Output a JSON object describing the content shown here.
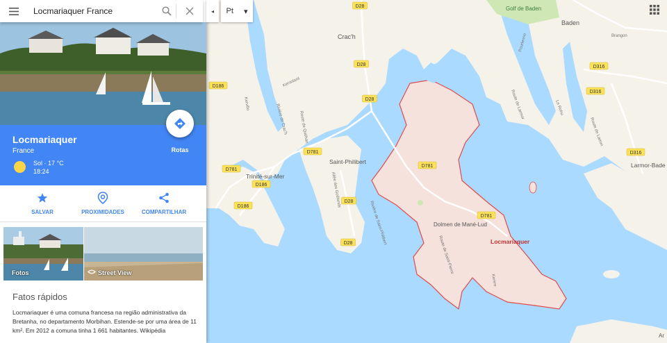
{
  "search": {
    "query": "Locmariaquer France"
  },
  "toggle": {
    "arrow": "◂"
  },
  "language": {
    "selected": "Pt",
    "arrow": "▾"
  },
  "place": {
    "name": "Locmariaquer",
    "country": "France",
    "weather": "Sol · 17 °C",
    "time": "18:24",
    "directions_label": "Rotas"
  },
  "actions": [
    {
      "label": "SALVAR",
      "icon": "star-icon"
    },
    {
      "label": "PROXIMIDADES",
      "icon": "nearby-icon"
    },
    {
      "label": "COMPARTILHAR",
      "icon": "share-icon"
    }
  ],
  "photos": {
    "photos_label": "Fotos",
    "streetview_label": "Street View"
  },
  "facts": {
    "title": "Fatos rápidos",
    "text": "Locmariaquer é uma comuna francesa na região administrativa da Bretanha, no departamento Morbihan. Estende-se por uma área de 11 km². Em 2012 a comuna tinha 1 661 habitantes. Wikipédia"
  },
  "map": {
    "colors": {
      "water": "#aadaff",
      "land": "#f5f2e9",
      "highlight": "#f6e2dc",
      "boundary": "#e04b4b",
      "park": "#cfe7b5",
      "road_label_bg": "#fce15a"
    },
    "labels": {
      "crach": "Crac'h",
      "baden": "Baden",
      "golf": "Golf de Baden",
      "saint_philibert": "Saint-Philibert",
      "trinite": "Trinité-sur-Mer",
      "dolmen": "Dolmen de Mané-Lud",
      "locmariaquer": "Locmariaquer",
      "larmor": "Larmor-Bade",
      "kersolard": "Kersolard",
      "riviere_crach": "Rivière de Crac'h",
      "route_quehan": "Route de Quéhan",
      "allee_goelands": "Allée des Goélands",
      "riviere_philibert": "Rivière de Saint-Philibert",
      "route_saint_pierre": "Route de Saint-Pierre",
      "kerere": "Kerere",
      "brangon": "Brangon",
      "pourlenno": "Pourlenno",
      "route_de_larmor": "Route de Larmor",
      "le_rohu": "Le Rohu",
      "route_de_larron": "Route de Larron",
      "ar": "Ar",
      "kervillo": "Kervillo"
    },
    "roads": [
      "D28",
      "D28",
      "D28",
      "D28",
      "D28",
      "D781",
      "D781",
      "D781",
      "D781",
      "D186",
      "D186",
      "D186",
      "D316",
      "D316",
      "D316"
    ]
  }
}
